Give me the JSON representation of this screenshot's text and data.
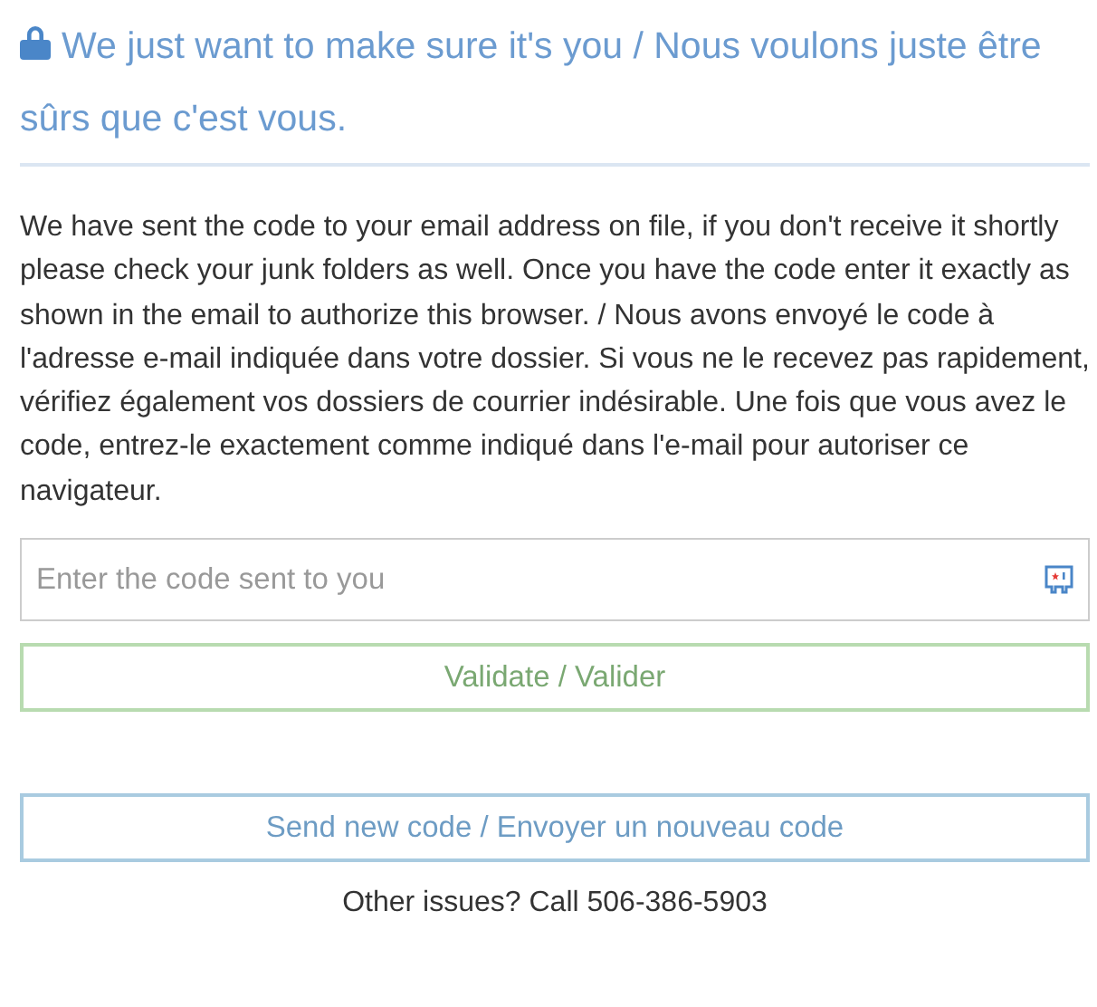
{
  "heading": "We just want to make sure it's you / Nous voulons juste être sûrs que c'est vous.",
  "message": "We have sent the code to your email address on file, if you don't receive it shortly please check your junk folders as well. Once you have the code enter it exactly as shown in the email to authorize this browser. / Nous avons envoyé le code à l'adresse e-mail indiquée dans votre dossier. Si vous ne le recevez pas rapidement, vérifiez également vos dossiers de courrier indésirable. Une fois que vous avez le code, entrez-le exactement comme indiqué dans l'e-mail pour autoriser ce navigateur.",
  "code_field": {
    "placeholder": "Enter the code sent to you"
  },
  "buttons": [
    {
      "kind": "primary",
      "label": "Validate / Valider"
    },
    {
      "kind": "secondary",
      "label": "Send new code / Envoyer un nouveau code"
    }
  ],
  "footer": "Other issues? Call 506-386-5903"
}
